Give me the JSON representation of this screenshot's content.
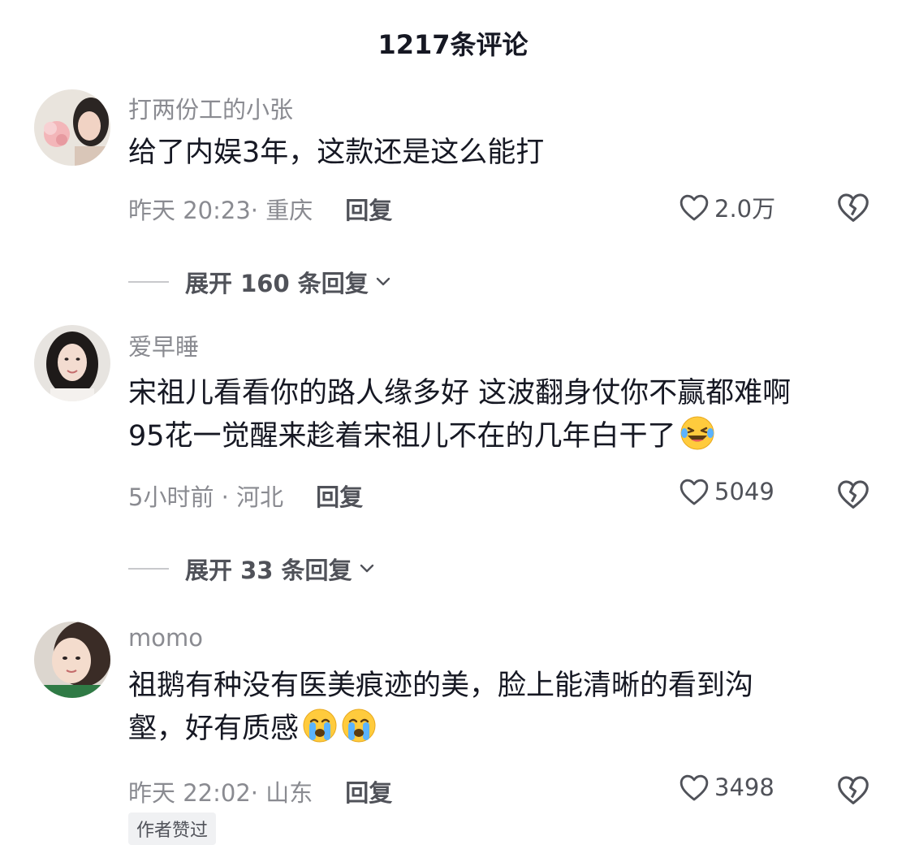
{
  "header": {
    "title": "1217条评论"
  },
  "comments": [
    {
      "username": "打两份工的小张",
      "lines": [
        "给了内娱3年，这款还是这么能打"
      ],
      "time_location": "昨天 20:23· 重庆",
      "reply_label": "回复",
      "likes": "2.0万",
      "expand_label": "展开 160 条回复"
    },
    {
      "username": "爱早睡",
      "lines": [
        "宋祖儿看看你的路人缘多好 这波翻身仗你不赢都难啊",
        "95花一觉醒来趁着宋祖儿不在的几年白干了"
      ],
      "time_location": "5小时前 · 河北",
      "reply_label": "回复",
      "likes": "5049",
      "expand_label": "展开 33 条回复"
    },
    {
      "username": "momo",
      "lines": [
        "祖鹅有种没有医美痕迹的美，脸上能清晰的看到沟",
        "壑，好有质感"
      ],
      "time_location": "昨天 22:02· 山东",
      "reply_label": "回复",
      "likes": "3498",
      "badge": "作者赞过"
    }
  ],
  "icons": {
    "like": "heart-outline-icon",
    "dislike": "broken-heart-icon",
    "expand": "chevron-down-icon",
    "emoji_laugh": "laugh-cry-emoji",
    "emoji_cry": "crying-emoji"
  }
}
